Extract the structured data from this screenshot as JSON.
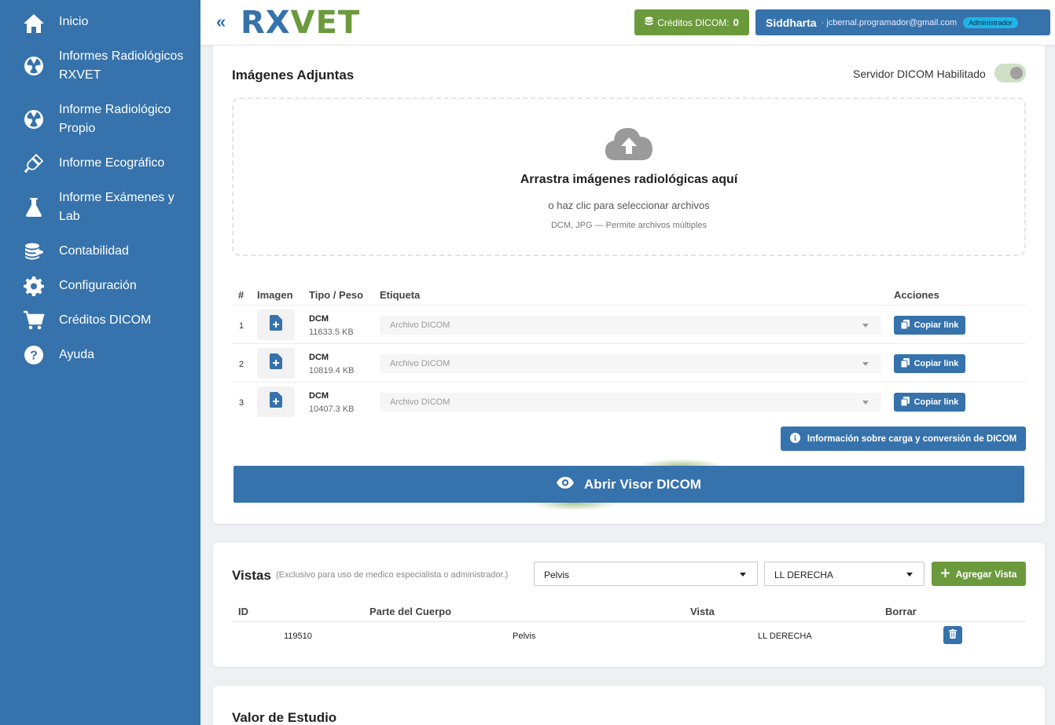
{
  "sidebar": {
    "items": [
      {
        "label": "Inicio",
        "icon": "home-icon"
      },
      {
        "label": "Informes Radiológicos RXVET",
        "icon": "radiation-icon"
      },
      {
        "label": "Informe Radiológico Propio",
        "icon": "radiation-icon"
      },
      {
        "label": "Informe Ecográfico",
        "icon": "ultrasound-probe-icon"
      },
      {
        "label": "Informe Exámenes y Lab",
        "icon": "flask-icon"
      },
      {
        "label": "Contabilidad",
        "icon": "coins-icon"
      },
      {
        "label": "Configuración",
        "icon": "gear-icon"
      },
      {
        "label": "Créditos DICOM",
        "icon": "cart-icon"
      },
      {
        "label": "Ayuda",
        "icon": "help-icon"
      }
    ]
  },
  "header": {
    "collapse_glyph": "«",
    "logo_rx": "RX",
    "logo_vet": "VET",
    "credits_label": "Créditos DICOM:",
    "credits_count": "0",
    "user_name": "Siddharta",
    "user_email": "· jcbernal.programador@gmail.com",
    "user_role": "Administrador"
  },
  "images": {
    "title": "Imágenes Adjuntas",
    "toggle_label": "Servidor DICOM Habilitado",
    "toggle_on": true,
    "dropzone": {
      "title": "Arrastra imágenes radiológicas aquí",
      "subtitle": "o haz clic para seleccionar archivos",
      "hint": "DCM, JPG — Permite archivos múltiples"
    },
    "columns": [
      "#",
      "Imagen",
      "Tipo / Peso",
      "Etiqueta",
      "Acciones"
    ],
    "rows": [
      {
        "num": "1",
        "type": "DCM",
        "size": "11633.5 KB",
        "label": "Archivo DICOM",
        "action": "Copiar link"
      },
      {
        "num": "2",
        "type": "DCM",
        "size": "10819.4 KB",
        "label": "Archivo DICOM",
        "action": "Copiar link"
      },
      {
        "num": "3",
        "type": "DCM",
        "size": "10407.3 KB",
        "label": "Archivo DICOM",
        "action": "Copiar link"
      }
    ],
    "info_button": "Información sobre carga y conversión de DICOM",
    "viewer_button": "Abrir Visor DICOM"
  },
  "vistas": {
    "title": "Vistas",
    "note": "(Exclusivo para uso de medico especialista o administrador.)",
    "body_part_selected": "Pelvis",
    "view_selected": "LL DERECHA",
    "add_button": "Agregar Vista",
    "columns": [
      "ID",
      "Parte del Cuerpo",
      "Vista",
      "Borrar"
    ],
    "rows": [
      {
        "id": "119510",
        "body_part": "Pelvis",
        "view": "LL DERECHA"
      }
    ]
  },
  "valor": {
    "title": "Valor de Estudio"
  },
  "colors": {
    "primary": "#3672ab",
    "accent_green": "#6b9a3c",
    "badge": "#1fb5e6"
  }
}
